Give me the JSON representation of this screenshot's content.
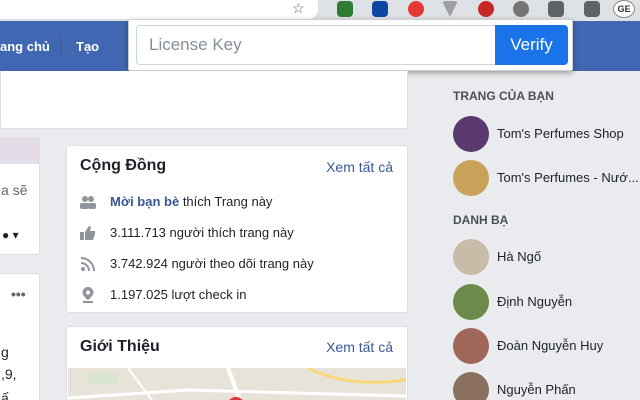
{
  "license": {
    "placeholder": "License Key",
    "verify_label": "Verify"
  },
  "nav": {
    "home_label": "ang chủ",
    "create_label": "Tạo"
  },
  "chrome": {
    "avatar_text": "GE"
  },
  "left_fragments": {
    "see_more": "a sẽ",
    "post_line1": "g",
    "post_line2": ",9,",
    "post_line3": "ấ"
  },
  "community": {
    "title": "Cộng Đồng",
    "see_all": "Xem tất cả",
    "friends_link": "Mời bạn bè",
    "friends_suffix": " thích Trang này",
    "likes": "3.111.713 người thích trang này",
    "follows": "3.742.924 người theo dõi trang này",
    "checkins": "1.197.025 lượt check in"
  },
  "about": {
    "title": "Giới Thiệu",
    "see_all": "Xem tất cả"
  },
  "sidebar": {
    "pages_heading": "TRANG CỦA BẠN",
    "pages": [
      {
        "name": "Tom's Perfumes Shop",
        "color": "#5a3a6e"
      },
      {
        "name": "Tom's Perfumes - Nướ...",
        "color": "#c9a25a"
      }
    ],
    "contacts_heading": "DANH BẠ",
    "contacts": [
      {
        "name": "Hà Ngố",
        "color": "#c8bba8"
      },
      {
        "name": "Định Nguyễn",
        "color": "#6c8a4a"
      },
      {
        "name": "Đoàn Nguyễn Huy",
        "color": "#a0665a"
      },
      {
        "name": "Nguyễn Phấn",
        "color": "#8a6e5e"
      }
    ]
  },
  "colors": {
    "fb_blue": "#4267b2",
    "verify_blue": "#1a73e8",
    "link": "#385898"
  }
}
